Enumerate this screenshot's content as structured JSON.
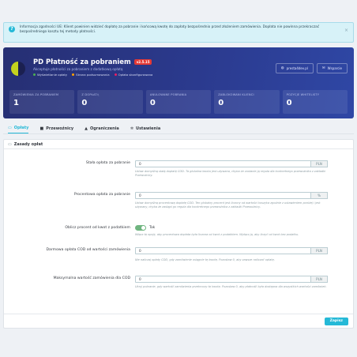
{
  "notice": {
    "text": "Informacja zgodności UE: Klient powinien widzieć dopłatę za pobranie i końcową kwotę do zapłaty bezpośrednio przed złożeniem zamówienia. Dopłata nie powinna przekraczać bezpośredniego kosztu tej metody płatności.",
    "close": "×"
  },
  "header": {
    "title": "PD Płatność za pobraniem",
    "version": "v2.5.15",
    "subtitle": "Akceptuje płatności za pobraniem z dodatkową opłatą",
    "flags": [
      {
        "label": "Wyświetlanie opłaty",
        "color": "#4caf50"
      },
      {
        "label": "Strona podsumowania",
        "color": "#ffa000"
      },
      {
        "label": "Opłata skonfigurowana",
        "color": "#e91e63"
      }
    ],
    "buttons": [
      {
        "label": "presta4dev.pl",
        "icon": "globe-icon"
      },
      {
        "label": "Wsparcie",
        "icon": "envelope-icon"
      }
    ]
  },
  "stats": [
    {
      "label": "ZAMÓWIENIA ZA POBRANIEM",
      "value": "1"
    },
    {
      "label": "Z DOPŁATĄ",
      "value": "0"
    },
    {
      "label": "ANULOWANE POBRANIA",
      "value": "0"
    },
    {
      "label": "ZABLOKOWANI KLIENCI",
      "value": "0"
    },
    {
      "label": "POZYCJE WHITELISTY",
      "value": "0"
    }
  ],
  "tabs": [
    {
      "label": "Opłaty",
      "icon": "money-icon"
    },
    {
      "label": "Przewoźnicy",
      "icon": "truck-icon"
    },
    {
      "label": "Ograniczenia",
      "icon": "lock-icon"
    },
    {
      "label": "Ustawienia",
      "icon": "gears-icon"
    }
  ],
  "panel": {
    "title": "Zasady opłat",
    "fields": {
      "fixed_fee": {
        "label": "Stała opłata za pobranie",
        "value": "0",
        "unit": "PLN",
        "help": "Ustaw domyślną stałą dopłatę COD. Ta globalna kwota jest używana, chyba że zostanie ją reguła dla konkretnego przewoźnika z zakładki Przewoźnicy."
      },
      "percent_fee": {
        "label": "Procentowa opłata za pobranie",
        "value": "0",
        "unit": "%",
        "help": "Ustaw domyślną procentową dopłatę COD. Ten globalny procent jest liczony od wartości koszyka zgodnie z ustawieniem poniżej i jest używany, chyba że zastąpi go reguła dla konkretnego przewoźnika z zakładki Przewoźnicy."
      },
      "tax_toggle": {
        "label": "Oblicz procent od kwot z podatkiem",
        "state": "Tak",
        "help": "Włącz tę opcję, aby procentowa dopłata była liczona od kwot z podatkiem. Wyłącz ją, aby liczyć od kwot bez podatku."
      },
      "free_threshold": {
        "label": "Darmowa opłata COD od wartości zamówienia",
        "value": "0",
        "unit": "PLN",
        "help": "Nie naliczaj opłaty COD, gdy zamówienie osiągnie tę kwotę. Pozostaw 0, aby zawsze naliczać opłatę."
      },
      "max_order": {
        "label": "Maksymalna wartość zamówienia dla COD",
        "value": "0",
        "unit": "PLN",
        "help": "Ukryj pobranie, gdy wartość zamówienia przekroczy tę kwotę. Pozostaw 0, aby płatność była dostępna dla wszystkich wartości zamówień."
      }
    },
    "save_label": "Zapisz"
  }
}
